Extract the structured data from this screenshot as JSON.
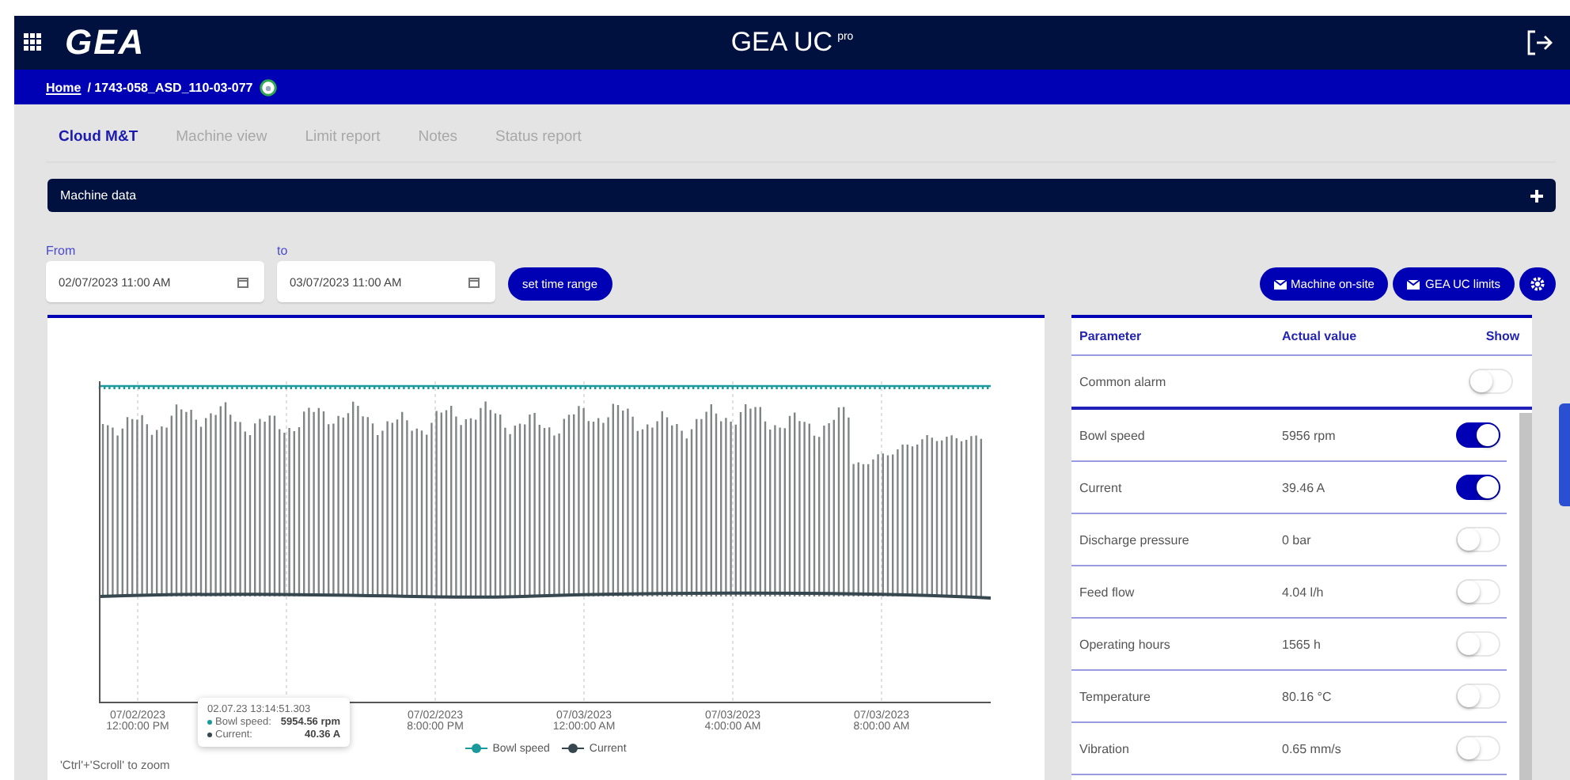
{
  "header": {
    "brand": "GEA",
    "title": "GEA UC",
    "title_sup": "pro"
  },
  "breadcrumb": {
    "home": "Home",
    "path": "/ 1743-058_ASD_110-03-077"
  },
  "tabs": [
    {
      "label": "Cloud M&T",
      "selected": true
    },
    {
      "label": "Machine view",
      "selected": false
    },
    {
      "label": "Limit report",
      "selected": false
    },
    {
      "label": "Notes",
      "selected": false
    },
    {
      "label": "Status report",
      "selected": false
    }
  ],
  "section": {
    "title": "Machine data",
    "expanded": false
  },
  "time_range": {
    "from_label": "From",
    "from_value": "02/07/2023 11:00 AM",
    "to_label": "to",
    "to_value": "03/07/2023 11:00 AM",
    "button": "set time range"
  },
  "actions": [
    "Machine on-site",
    "GEA UC limits"
  ],
  "chart": {
    "x_labels": [
      [
        "07/02/2023",
        "12:00:00 PM"
      ],
      [
        "07/02/2023",
        "8:00:00 PM"
      ],
      [
        "07/03/2023",
        "12:00:00 AM"
      ],
      [
        "07/03/2023",
        "4:00:00 AM"
      ],
      [
        "07/03/2023",
        "8:00:00 AM"
      ]
    ],
    "tooltip": {
      "time": "02.07.23 13:14:51.303",
      "rows": [
        {
          "label": "Bowl speed:",
          "value": "5954.56 rpm",
          "color": "#1a9a9a"
        },
        {
          "label": "Current:",
          "value": "40.36 A",
          "color": "#37474f"
        }
      ]
    },
    "legend": [
      {
        "name": "Bowl speed",
        "color": "#1a9a9a"
      },
      {
        "name": "Current",
        "color": "#37474f"
      }
    ],
    "hint": "'Ctrl'+'Scroll' to zoom"
  },
  "table": {
    "columns": [
      "Parameter",
      "Actual value",
      "Show"
    ],
    "pinned": {
      "name": "Common alarm",
      "on": false
    },
    "rows": [
      {
        "name": "Bowl speed",
        "value": "5956 rpm",
        "on": true
      },
      {
        "name": "Current",
        "value": "39.46 A",
        "on": true
      },
      {
        "name": "Discharge pressure",
        "value": "0 bar",
        "on": false
      },
      {
        "name": "Feed flow",
        "value": "4.04 l/h",
        "on": false
      },
      {
        "name": "Operating hours",
        "value": "1565 h",
        "on": false
      },
      {
        "name": "Temperature",
        "value": "80.16 °C",
        "on": false
      },
      {
        "name": "Vibration",
        "value": "0.65 mm/s",
        "on": false
      }
    ]
  }
}
